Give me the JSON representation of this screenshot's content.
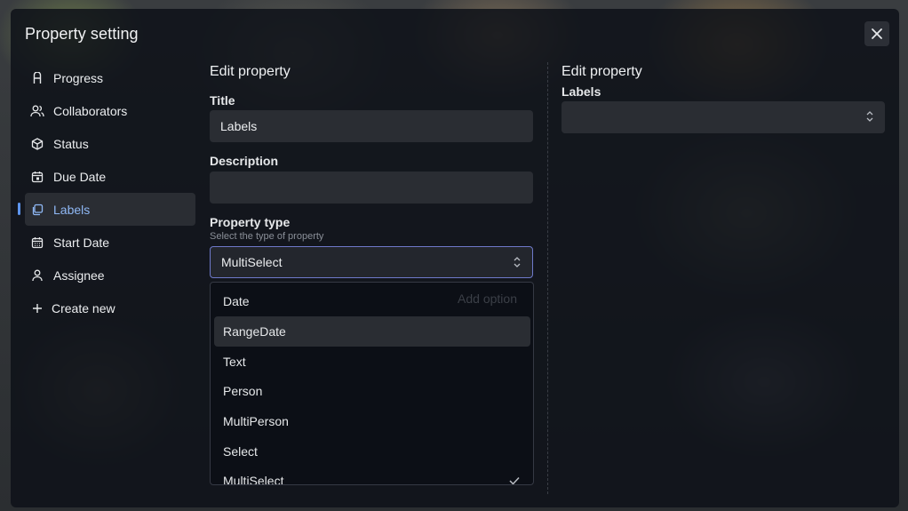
{
  "modal": {
    "title": "Property setting"
  },
  "sidebar": {
    "items": [
      {
        "label": "Progress",
        "icon": "progress-icon"
      },
      {
        "label": "Collaborators",
        "icon": "users-icon"
      },
      {
        "label": "Status",
        "icon": "cube-icon"
      },
      {
        "label": "Due Date",
        "icon": "calendar-icon"
      },
      {
        "label": "Labels",
        "icon": "copy-icon",
        "active": true
      },
      {
        "label": "Start Date",
        "icon": "calendar-grid-icon"
      },
      {
        "label": "Assignee",
        "icon": "user-icon"
      }
    ],
    "create_label": "Create new"
  },
  "left": {
    "heading": "Edit property",
    "title_label": "Title",
    "title_value": "Labels",
    "description_label": "Description",
    "description_value": "",
    "type_label": "Property type",
    "type_helper": "Select the type of property",
    "type_value": "MultiSelect",
    "add_option": "Add option"
  },
  "dropdown": {
    "options": [
      "Date",
      "RangeDate",
      "Text",
      "Person",
      "MultiPerson",
      "Select",
      "MultiSelect"
    ],
    "highlighted": "RangeDate",
    "selected": "MultiSelect"
  },
  "right": {
    "heading": "Edit property",
    "field_label": "Labels",
    "field_value": ""
  },
  "colors": {
    "accent": "#5d95ee",
    "active_text": "#8fb8f5",
    "focus_border": "#6e79c9",
    "modal_bg": "#0e1118"
  }
}
